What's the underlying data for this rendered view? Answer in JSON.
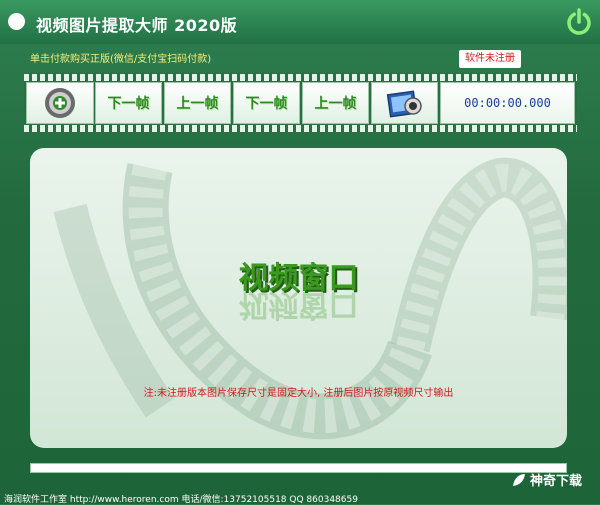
{
  "window": {
    "title": "视频图片提取大师  2020版"
  },
  "header": {
    "buy_text": "单击付款购买正版(微信/支付宝扫码付款)",
    "register_badge": "软件未注册"
  },
  "toolbar": {
    "buttons": [
      {
        "label": "",
        "icon": "add-film-icon"
      },
      {
        "label": "下一帧"
      },
      {
        "label": "上一帧"
      },
      {
        "label": "下一帧"
      },
      {
        "label": "上一帧"
      },
      {
        "label": "",
        "icon": "photo-capture-icon"
      }
    ],
    "timecode": "00:00:00.000"
  },
  "video": {
    "placeholder": "视频窗口",
    "note": "注:未注册版本图片保存尺寸是固定大小, 注册后图片按原视频尺寸输出"
  },
  "progress": {
    "value": 0
  },
  "footer": {
    "status": "海润软件工作室 http://www.heroren.com 电话/微信:13752105518 QQ 860348659",
    "logo_text": "神奇下载"
  },
  "colors": {
    "accent": "#2e7a4a",
    "label_green": "#2d8a1e",
    "warning_red": "#cc1a1a",
    "timecode_blue": "#1a3f9a"
  }
}
